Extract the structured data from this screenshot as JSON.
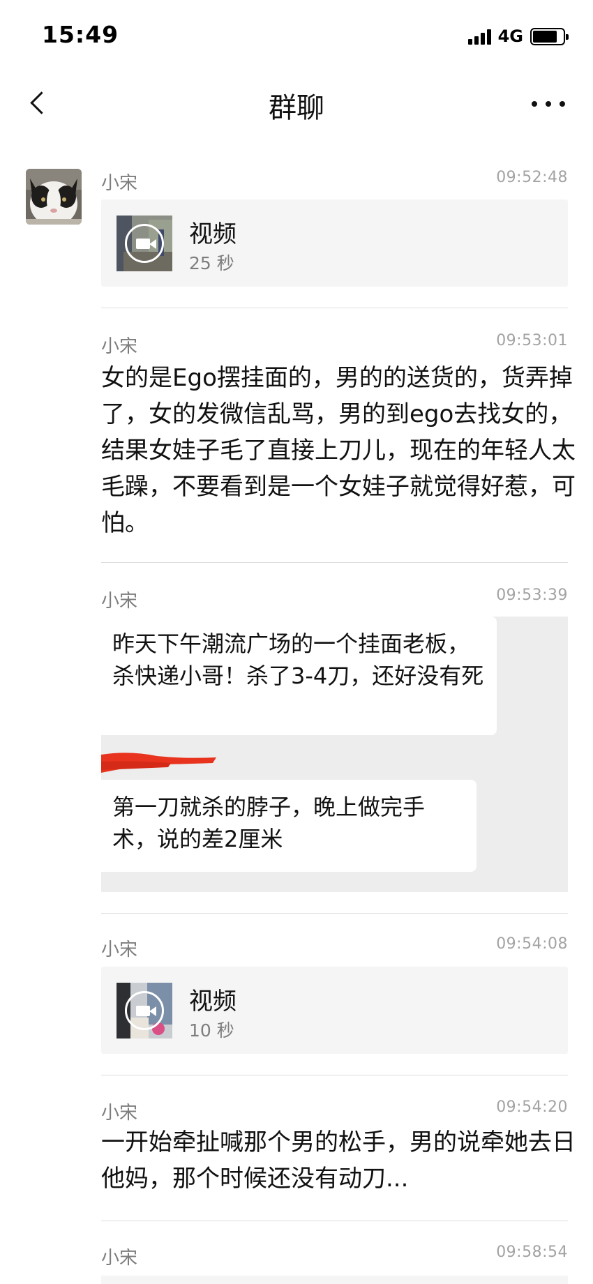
{
  "status_bar": {
    "time": "15:49",
    "network": "4G"
  },
  "nav": {
    "title": "群聊",
    "back_icon": "chevron-left-icon",
    "more_icon": "ellipsis-icon"
  },
  "messages": [
    {
      "sender": "小宋",
      "time": "09:52:48",
      "type": "video",
      "label": "视频",
      "duration": "25 秒"
    },
    {
      "sender": "小宋",
      "time": "09:53:01",
      "type": "text",
      "text": "女的是Ego摆挂面的，男的的送货的，货弄掉了，女的发微信乱骂，男的到ego去找女的，结果女娃子毛了直接上刀儿，现在的年轻人太毛躁，不要看到是一个女娃子就觉得好惹，可怕。"
    },
    {
      "sender": "小宋",
      "time": "09:53:39",
      "type": "image",
      "bubble_1": "昨天下午潮流广场的一个挂面老板，杀快递小哥！杀了3-4刀，还好没有死",
      "bubble_2": "第一刀就杀的脖子，晚上做完手术，说的差2厘米"
    },
    {
      "sender": "小宋",
      "time": "09:54:08",
      "type": "video",
      "label": "视频",
      "duration": "10 秒"
    },
    {
      "sender": "小宋",
      "time": "09:54:20",
      "type": "text",
      "text": "一开始牵扯喊那个男的松手，男的说牵她去日他妈，那个时候还没有动刀..."
    },
    {
      "sender": "小宋",
      "time": "09:58:54",
      "type": "partial"
    }
  ]
}
